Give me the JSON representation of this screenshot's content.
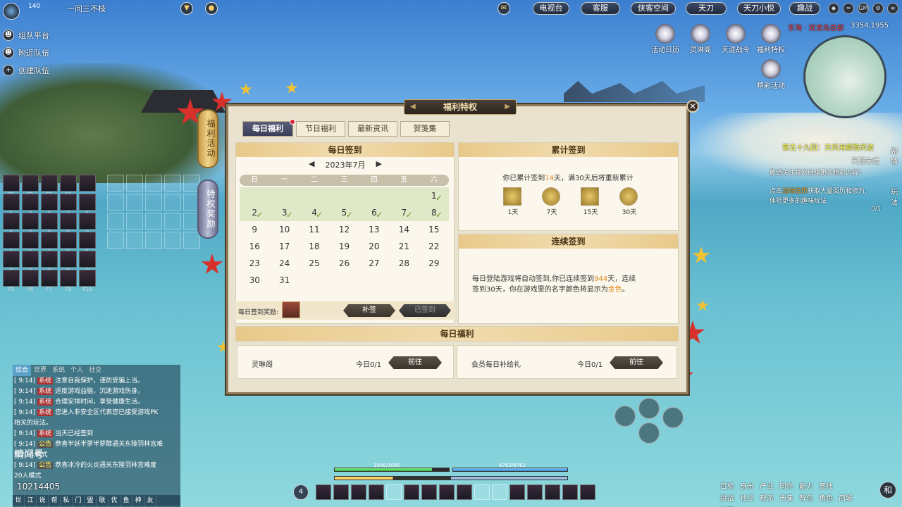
{
  "topbar": {
    "level": "140",
    "player_name": "一问三不枝",
    "buttons": [
      "电视台",
      "客服",
      "侠客空间",
      "天刀小悦",
      "趣战"
    ],
    "brand_button": "天刀",
    "system_icons": [
      "GM"
    ]
  },
  "team": {
    "items": [
      {
        "label": "组队平台",
        "icon": "people-icon"
      },
      {
        "label": "附近队伍",
        "icon": "people-icon"
      },
      {
        "label": "创建队伍",
        "icon": "plus-icon"
      }
    ]
  },
  "skills": {
    "keys": [
      "F1",
      "F2",
      "F3",
      "F4",
      "",
      "1",
      "2",
      "3",
      "4",
      "5",
      "6",
      "7",
      "8",
      "9",
      "0",
      "1",
      "2",
      "3",
      "4",
      "5",
      "6",
      "7",
      "8",
      "9",
      "0",
      "F5",
      "F6",
      "F7",
      "F8",
      "F10"
    ],
    "counts": [
      "2821",
      "531",
      "39"
    ]
  },
  "side_tabs": {
    "active": "福利活动",
    "normal": "特权奖励"
  },
  "panel": {
    "title": "福利特权",
    "tabs": [
      "每日福利",
      "节日福利",
      "最新资讯",
      "贺笺集"
    ],
    "daily_signin": {
      "header": "每日签到",
      "month": "2023年7月",
      "weekdays": [
        "日",
        "一",
        "二",
        "三",
        "四",
        "五",
        "六"
      ],
      "leading_blanks": 6,
      "days_in_month": 31,
      "signed_days": [
        1,
        2,
        3,
        4,
        5,
        6,
        7,
        8
      ],
      "reward_label": "每日签到奖励:",
      "makeup_btn": "补签",
      "signed_btn": "已签到"
    },
    "accumulated": {
      "header": "累计签到",
      "text_prefix": "你已累计签到",
      "days": "14",
      "text_suffix": "天，满30天后将重新累计",
      "rewards": [
        {
          "label": "1天"
        },
        {
          "label": "7天"
        },
        {
          "label": "15天"
        },
        {
          "label": "30天"
        }
      ]
    },
    "consecutive": {
      "header": "连续签到",
      "line_a": "每日登陆游戏将自动签到,你已连续签到",
      "days": "944",
      "line_b": "天，连续",
      "line_c": "签到30天，你在游戏里的名字颜色将显示为",
      "color_word": "金色",
      "period": "。"
    },
    "welfare": {
      "header": "每日福利",
      "rows": [
        {
          "name": "灵琳阁",
          "count": "今日0/1",
          "btn": "前往"
        },
        {
          "name": "会员每日补给礼",
          "count": "今日0/1",
          "btn": "前往"
        }
      ]
    }
  },
  "hud": {
    "icons": [
      "活动日历",
      "灵琳阁",
      "天涯战令",
      "福利特权",
      "精彩活动"
    ],
    "location": "东海 · 双龙岛总部",
    "coords": "3354,1955",
    "side_labels": [
      "剧情",
      "玩法"
    ],
    "quest": {
      "title": "第五十九回：天风海雾隐风波",
      "sub": "天涯未远",
      "line1": "敬请关注官网后续更多精彩内容！",
      "line2_a": "点击",
      "line2_hl": "活动日历",
      "line2_b": "获取大量阅历和修为,",
      "line3": "体验更多的趣味玩法",
      "progress": "0/1"
    }
  },
  "chat": {
    "tabs": [
      "综合",
      "世界",
      "系统",
      "个人",
      "社交"
    ],
    "lines": [
      {
        "time": "[ 9:14]",
        "tag": "系统",
        "text": "注意自我保护，谨防受骗上当。"
      },
      {
        "time": "[ 9:14]",
        "tag": "系统",
        "text": "适度游戏益脑，沉迷游戏伤身。"
      },
      {
        "time": "[ 9:14]",
        "tag": "系统",
        "text": "合理安排时间，享受健康生活。"
      },
      {
        "time": "[ 9:14]",
        "tag": "系统",
        "text": "您进入非安全区代表您已接受游戏PK"
      },
      {
        "time": "",
        "tag": "",
        "text": "相关的玩法。"
      },
      {
        "time": "[ 9:14]",
        "tag": "系统",
        "text": "当天已经签到"
      },
      {
        "time": "[ 9:14]",
        "tag": "公告",
        "text": "恭喜半妖半萝半萝醇通关东陵羽林宫难"
      },
      {
        "time": "",
        "tag": "",
        "text": "度20人模式"
      },
      {
        "time": "[ 9:14]",
        "tag": "公告",
        "text": "恭喜冰冷的火炎通关东陵羽林宫难度"
      },
      {
        "time": "",
        "tag": "",
        "text": "20人模式"
      }
    ],
    "watermark": "情闻号",
    "uid": "10214405",
    "bottom": [
      "世",
      "江",
      "说",
      "帮",
      "私",
      "门",
      "盟",
      "联",
      "优",
      "鱼",
      "神",
      "友"
    ]
  },
  "status": {
    "hp": "1080/1080",
    "mp": "8763/8763",
    "hp_fraction": 0.85,
    "mp_fraction": 1.0,
    "stance": "4"
  },
  "menu": [
    "目标",
    "身份",
    "产业",
    "同伴",
    "能力",
    "竞技",
    "",
    "挑战",
    "社交",
    "帮派",
    "市集",
    "背包",
    "角色",
    "商城",
    "外观"
  ],
  "menu_last": "和"
}
